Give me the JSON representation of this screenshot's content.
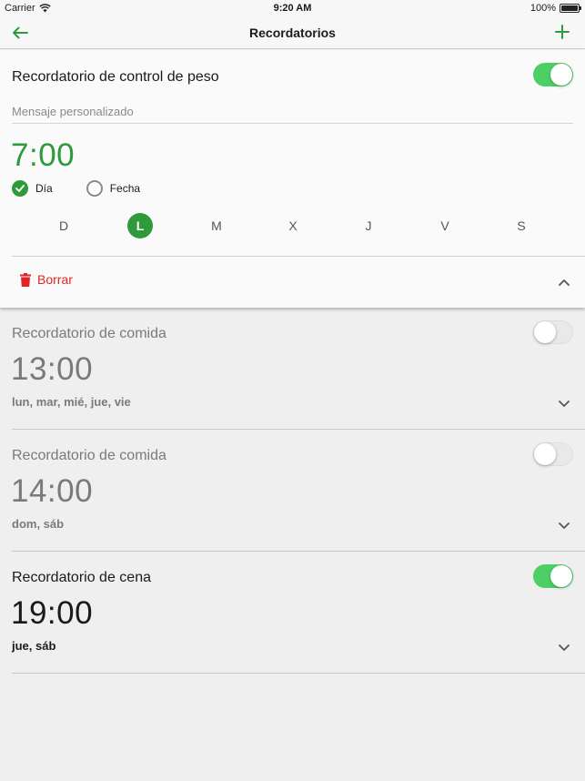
{
  "status_bar": {
    "carrier": "Carrier",
    "time": "9:20 AM",
    "battery": "100%"
  },
  "nav": {
    "title": "Recordatorios",
    "back_icon": "arrow-left-icon",
    "add_icon": "plus-icon"
  },
  "colors": {
    "accent": "#2e9a3a",
    "toggle_on": "#4cd065",
    "delete": "#e02424"
  },
  "expanded_reminder": {
    "title": "Recordatorio de control de peso",
    "enabled": true,
    "message_placeholder": "Mensaje personalizado",
    "time": "7:00",
    "options": {
      "day_label": "Día",
      "date_label": "Fecha",
      "selected": "Día"
    },
    "weekdays": [
      "D",
      "L",
      "M",
      "X",
      "J",
      "V",
      "S"
    ],
    "selected_weekday": "L",
    "delete_label": "Borrar"
  },
  "reminders": [
    {
      "title": "Recordatorio de comida",
      "time": "13:00",
      "days": "lun, mar, mié, jue, vie",
      "enabled": false
    },
    {
      "title": "Recordatorio de comida",
      "time": "14:00",
      "days": "dom, sáb",
      "enabled": false
    },
    {
      "title": "Recordatorio de cena",
      "time": "19:00",
      "days": "jue, sáb",
      "enabled": true
    }
  ]
}
